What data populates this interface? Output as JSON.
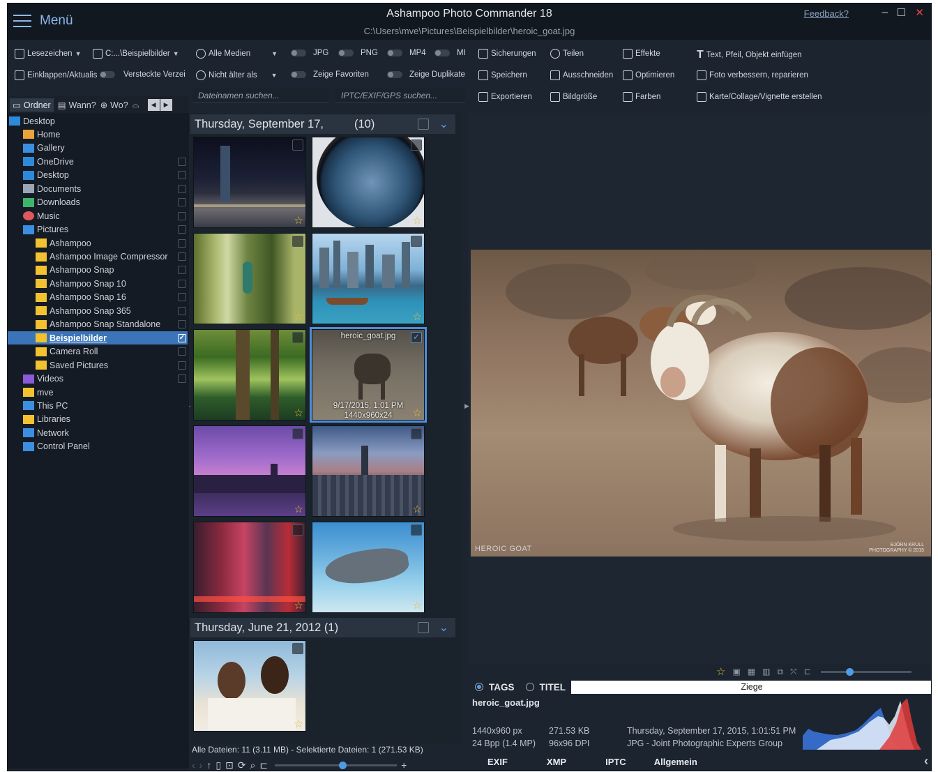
{
  "window": {
    "menu_label": "Menü",
    "title": "Ashampoo Photo Commander 18",
    "path": "C:\\Users\\mve\\Pictures\\Beispielbilder\\heroic_goat.jpg",
    "feedback": "Feedback?",
    "minimize": "–",
    "maximize": "☐",
    "close": "✕"
  },
  "toolbar": {
    "bookmarks": "Lesezeichen",
    "path_short": "C:...\\Beispielbilder",
    "all_media": "Alle Medien",
    "jpg": "JPG",
    "png": "PNG",
    "mp4": "MP4",
    "more": "MI",
    "collapse": "Einklappen/Aktualis",
    "hidden": "Versteckte Verzei",
    "not_older": "Nicht älter als",
    "show_favorites": "Zeige Favoriten",
    "show_duplicates": "Zeige Duplikate",
    "backups": "Sicherungen",
    "share": "Teilen",
    "effects": "Effekte",
    "insert_text": "Text, Pfeil, Objekt einfügen",
    "save": "Speichern",
    "cut": "Ausschneiden",
    "optimize": "Optimieren",
    "improve": "Foto verbessern, reparieren",
    "export": "Exportieren",
    "image_size": "Bildgröße",
    "colors": "Farben",
    "card": "Karte/Collage/Vignette erstellen",
    "filename_search_placeholder": "Dateinamen suchen...",
    "iptc_search_placeholder": "IPTC/EXIF/GPS suchen..."
  },
  "leftnav": {
    "folder": "Ordner",
    "when": "Wann?",
    "where": "Wo?"
  },
  "tree": [
    {
      "label": "Desktop",
      "icon": "desktop-icon",
      "indent": 0
    },
    {
      "label": "Home",
      "icon": "home-icon",
      "indent": 1
    },
    {
      "label": "Gallery",
      "icon": "gallery-icon",
      "indent": 1
    },
    {
      "label": "OneDrive",
      "icon": "cloud-icon",
      "indent": 1
    },
    {
      "label": "Desktop",
      "icon": "desktop-icon",
      "indent": 1
    },
    {
      "label": "Documents",
      "icon": "documents-icon",
      "indent": 1
    },
    {
      "label": "Downloads",
      "icon": "download-icon",
      "indent": 1
    },
    {
      "label": "Music",
      "icon": "music-icon",
      "indent": 1
    },
    {
      "label": "Pictures",
      "icon": "pictures-icon",
      "indent": 1
    },
    {
      "label": "Ashampoo",
      "icon": "folder-icon",
      "indent": 2
    },
    {
      "label": "Ashampoo Image Compressor",
      "icon": "folder-icon",
      "indent": 2
    },
    {
      "label": "Ashampoo Snap",
      "icon": "folder-icon",
      "indent": 2
    },
    {
      "label": "Ashampoo Snap 10",
      "icon": "folder-icon",
      "indent": 2
    },
    {
      "label": "Ashampoo Snap 16",
      "icon": "folder-icon",
      "indent": 2
    },
    {
      "label": "Ashampoo Snap 365",
      "icon": "folder-icon",
      "indent": 2
    },
    {
      "label": "Ashampoo Snap Standalone",
      "icon": "folder-icon",
      "indent": 2
    },
    {
      "label": "Beispielbilder",
      "icon": "folder-icon",
      "indent": 2,
      "selected": true
    },
    {
      "label": "Camera Roll",
      "icon": "folder-icon",
      "indent": 2
    },
    {
      "label": "Saved Pictures",
      "icon": "folder-icon",
      "indent": 2
    },
    {
      "label": "Videos",
      "icon": "videos-icon",
      "indent": 1
    },
    {
      "label": "mve",
      "icon": "folder-icon",
      "indent": 1
    },
    {
      "label": "This PC",
      "icon": "pc-icon",
      "indent": 1
    },
    {
      "label": "Libraries",
      "icon": "folder-icon",
      "indent": 1
    },
    {
      "label": "Network",
      "icon": "network-icon",
      "indent": 1
    },
    {
      "label": "Control Panel",
      "icon": "control-panel-icon",
      "indent": 1
    }
  ],
  "groups": {
    "g1_label": "Thursday, September 17,",
    "g1_count": "(10)",
    "g2_label": "Thursday, June 21, 2012  (1)"
  },
  "selected_thumb": {
    "name": "heroic_goat.jpg",
    "date": "9/17/2015, 1:01 PM",
    "dims": "1440x960x24"
  },
  "status": "Alle Dateien: 11 (3.11 MB) - Selektierte Dateien: 1 (271.53 KB)",
  "preview": {
    "caption_left": "HEROIC GOAT",
    "caption_right_1": "BJÖRN KRULL",
    "caption_right_2": "PHOTOGRAPHY © 2015"
  },
  "tags": {
    "tags_label": "TAGS",
    "title_label": "TITEL",
    "value": "Ziege"
  },
  "info": {
    "filename": "heroic_goat.jpg",
    "resolution": "1440x960 px",
    "bpp": "24 Bpp (1.4 MP)",
    "size": "271.53 KB",
    "dpi": "96x96 DPI",
    "date": "Thursday, September 17, 2015, 1:01:51 PM",
    "format": "JPG - Joint Photographic Experts Group"
  },
  "metatabs": {
    "exif": "EXIF",
    "xmp": "XMP",
    "iptc": "IPTC",
    "general": "Allgemein"
  }
}
